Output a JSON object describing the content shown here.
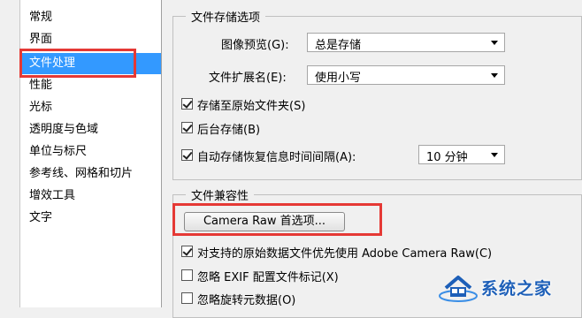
{
  "sidebar": {
    "items": [
      {
        "label": "常规",
        "selected": false
      },
      {
        "label": "界面",
        "selected": false
      },
      {
        "label": "文件处理",
        "selected": true
      },
      {
        "label": "性能",
        "selected": false
      },
      {
        "label": "光标",
        "selected": false
      },
      {
        "label": "透明度与色域",
        "selected": false
      },
      {
        "label": "单位与标尺",
        "selected": false
      },
      {
        "label": "参考线、网格和切片",
        "selected": false
      },
      {
        "label": "增效工具",
        "selected": false
      },
      {
        "label": "文字",
        "selected": false
      }
    ]
  },
  "file_saving": {
    "title": "文件存储选项",
    "image_preview_label": "图像预览(G):",
    "image_preview_value": "总是存储",
    "file_extension_label": "文件扩展名(E):",
    "file_extension_value": "使用小写",
    "save_to_original_folder": {
      "label": "存储至原始文件夹(S)",
      "checked": true
    },
    "background_save": {
      "label": "后台存储(B)",
      "checked": true
    },
    "autosave": {
      "label": "自动存储恢复信息时间间隔(A):",
      "checked": true
    },
    "autosave_interval_value": "10 分钟"
  },
  "compatibility": {
    "title": "文件兼容性",
    "camera_raw_button": "Camera Raw 首选项...",
    "prefer_camera_raw": {
      "label": "对支持的原始数据文件优先使用 Adobe Camera Raw(C)",
      "checked": true
    },
    "ignore_exif": {
      "label": "忽略 EXIF 配置文件标记(X)",
      "checked": false
    },
    "ignore_rotation": {
      "label": "忽略旋转元数据(O)",
      "checked": false
    }
  },
  "watermark": {
    "text": "系统之家"
  },
  "colors": {
    "selection": "#3399ff",
    "highlight_box": "#e53935"
  }
}
